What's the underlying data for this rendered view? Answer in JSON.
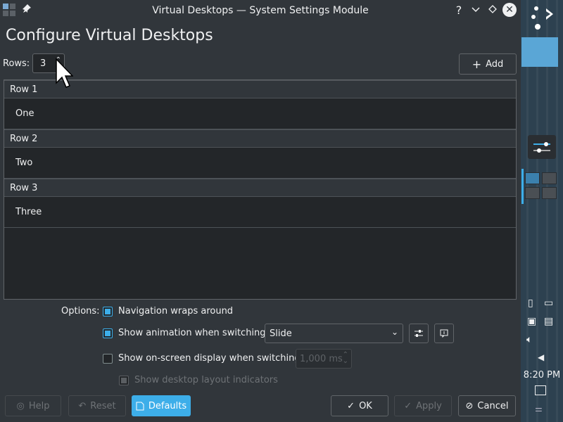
{
  "window": {
    "title": "Virtual Desktops — System Settings Module",
    "titlebar_buttons": [
      "help-icon",
      "minimize-icon",
      "keep-above-icon",
      "close-icon"
    ]
  },
  "heading": "Configure Virtual Desktops",
  "rows": {
    "label": "Rows:",
    "value": "3"
  },
  "add_button": {
    "label": "Add"
  },
  "desktop_list": [
    {
      "row": "Row 1",
      "desktop": "One"
    },
    {
      "row": "Row 2",
      "desktop": "Two"
    },
    {
      "row": "Row 3",
      "desktop": "Three"
    }
  ],
  "options": {
    "label": "Options:",
    "navigation_wraps": {
      "label": "Navigation wraps around",
      "checked": true
    },
    "show_animation": {
      "label": "Show animation when switching:",
      "checked": true,
      "selected": "Slide"
    },
    "show_osd": {
      "label": "Show on-screen display when switching:",
      "checked": false,
      "duration": "1,000 ms"
    },
    "show_layout": {
      "label": "Show desktop layout indicators",
      "checked": true,
      "disabled": true
    }
  },
  "footer": {
    "help": "Help",
    "reset": "Reset",
    "defaults": "Defaults",
    "ok": "OK",
    "apply": "Apply",
    "cancel": "Cancel"
  },
  "panel": {
    "clock": "8:20 PM"
  },
  "colors": {
    "accent": "#3daee9",
    "window_bg": "#31363b",
    "view_bg": "#232629",
    "panel_bg": "#2d4150"
  }
}
